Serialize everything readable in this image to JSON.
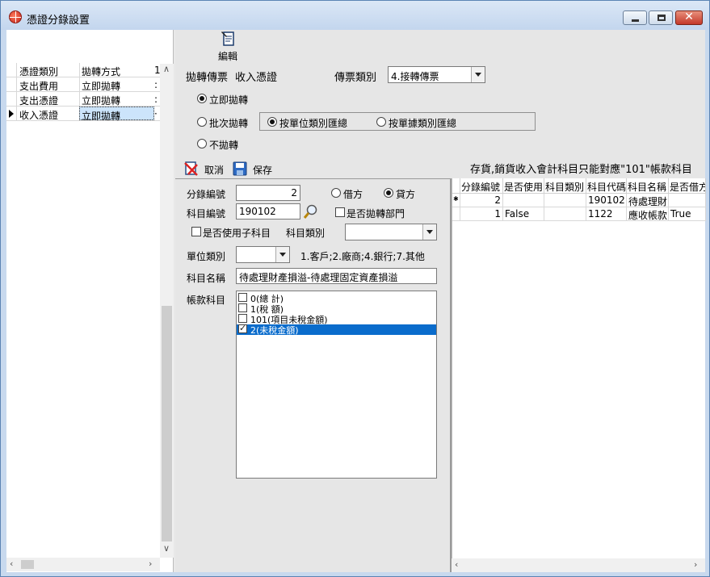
{
  "window": {
    "title": "憑證分錄設置"
  },
  "toolbar": {
    "edit_label": "編輯",
    "cancel_label": "取消",
    "save_label": "保存"
  },
  "left_grid": {
    "headers": [
      "憑證類別",
      "拋轉方式",
      "1"
    ],
    "rows": [
      {
        "type": "支出費用",
        "mode": "立即拋轉",
        "extra": ""
      },
      {
        "type": "支出憑證",
        "mode": "立即拋轉",
        "extra": ""
      },
      {
        "type": "收入憑證",
        "mode": "立即拋轉",
        "extra": ""
      }
    ]
  },
  "form": {
    "voucher_label": "拋轉傳票",
    "voucher_value": "收入憑證",
    "ticket_type_label": "傳票類別",
    "ticket_type_value": "4.接轉傳票",
    "radio_immediate": "立即拋轉",
    "radio_batch": "批次拋轉",
    "radio_by_unit": "按單位類別匯總",
    "radio_by_doc": "按單據類別匯總",
    "radio_none": "不拋轉",
    "notice": "存貨,銷貨收入會計科目只能對應\"101\"帳款科目",
    "entry_no_label": "分錄編號",
    "entry_no_value": "2",
    "debit_label": "借方",
    "credit_label": "貸方",
    "account_no_label": "科目編號",
    "account_no_value": "190102",
    "transfer_dept_label": "是否拋轉部門",
    "use_sub_label": "是否使用子科目",
    "account_type_label": "科目類別",
    "account_type_value": "",
    "unit_type_label": "單位類別",
    "unit_type_value": "",
    "unit_type_hint": "1.客戶;2.廠商;4.銀行;7.其他",
    "account_name_label": "科目名稱",
    "account_name_value": "待處理財產損溢-待處理固定資產損溢",
    "ledger_label": "帳款科目",
    "ledger_items": [
      {
        "label": "0(總        計)",
        "checked": false,
        "selected": false
      },
      {
        "label": "1(稅        額)",
        "checked": false,
        "selected": false
      },
      {
        "label": "101(項目未稅金額)",
        "checked": false,
        "selected": false
      },
      {
        "label": "2(未稅金額)",
        "checked": true,
        "selected": true
      }
    ]
  },
  "right_grid": {
    "headers": [
      "分錄編號",
      "是否使用",
      "科目類別",
      "科目代碼",
      "科目名稱",
      "是否借方"
    ],
    "rows": [
      {
        "no": "2",
        "use": "",
        "cat": "",
        "code": "190102",
        "name": "待處理財",
        "debit": ""
      },
      {
        "no": "1",
        "use": "False",
        "cat": "",
        "code": "1122",
        "name": "應收帳款",
        "debit": "True"
      }
    ]
  }
}
